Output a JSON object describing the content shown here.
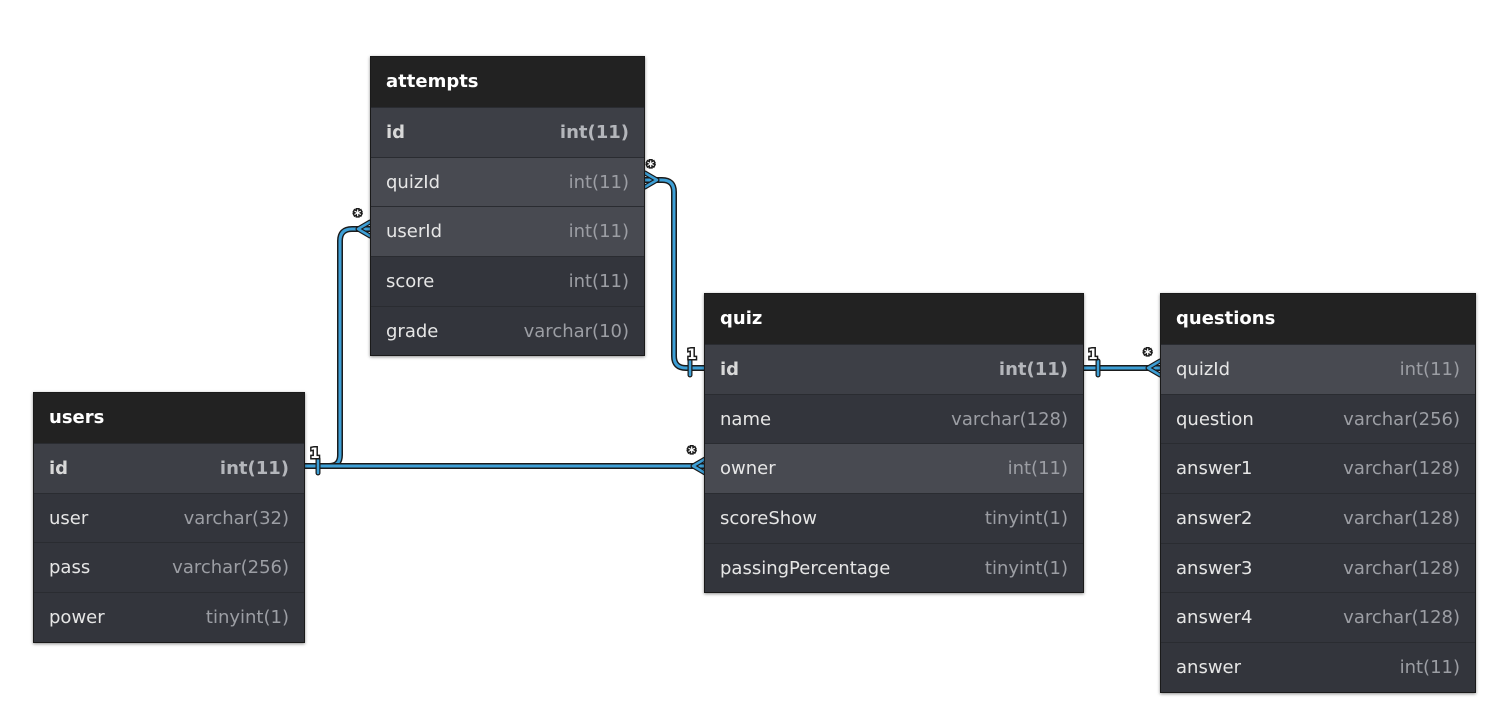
{
  "tables": {
    "attempts": {
      "name": "attempts",
      "columns": [
        {
          "name": "id",
          "type": "int(11)"
        },
        {
          "name": "quizId",
          "type": "int(11)"
        },
        {
          "name": "userId",
          "type": "int(11)"
        },
        {
          "name": "score",
          "type": "int(11)"
        },
        {
          "name": "grade",
          "type": "varchar(10)"
        }
      ]
    },
    "users": {
      "name": "users",
      "columns": [
        {
          "name": "id",
          "type": "int(11)"
        },
        {
          "name": "user",
          "type": "varchar(32)"
        },
        {
          "name": "pass",
          "type": "varchar(256)"
        },
        {
          "name": "power",
          "type": "tinyint(1)"
        }
      ]
    },
    "quiz": {
      "name": "quiz",
      "columns": [
        {
          "name": "id",
          "type": "int(11)"
        },
        {
          "name": "name",
          "type": "varchar(128)"
        },
        {
          "name": "owner",
          "type": "int(11)"
        },
        {
          "name": "scoreShow",
          "type": "tinyint(1)"
        },
        {
          "name": "passingPercentage",
          "type": "tinyint(1)"
        }
      ]
    },
    "questions": {
      "name": "questions",
      "columns": [
        {
          "name": "quizId",
          "type": "int(11)"
        },
        {
          "name": "question",
          "type": "varchar(256)"
        },
        {
          "name": "answer1",
          "type": "varchar(128)"
        },
        {
          "name": "answer2",
          "type": "varchar(128)"
        },
        {
          "name": "answer3",
          "type": "varchar(128)"
        },
        {
          "name": "answer4",
          "type": "varchar(128)"
        },
        {
          "name": "answer",
          "type": "int(11)"
        }
      ]
    }
  },
  "relationships": {
    "attempts_quiz": {
      "one": "1",
      "many": "*"
    },
    "attempts_users": {
      "one": "1",
      "many": "*"
    },
    "quiz_users": {
      "one": "1",
      "many": "*"
    },
    "questions_quiz": {
      "one": "1",
      "many": "*"
    }
  },
  "colors": {
    "connector": "#3d9fd6",
    "connector_outline": "#1b1b1b",
    "header_bg": "#222222",
    "body_bg": "#33353c"
  }
}
